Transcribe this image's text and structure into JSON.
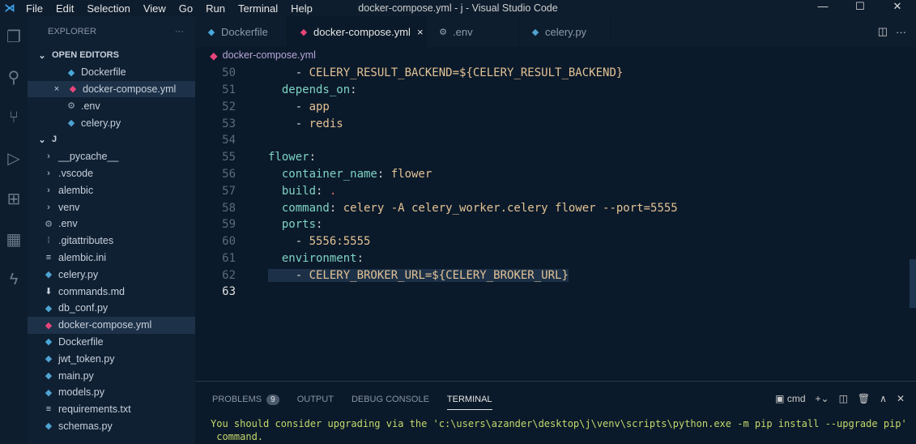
{
  "titlebar": {
    "menu": [
      "File",
      "Edit",
      "Selection",
      "View",
      "Go",
      "Run",
      "Terminal",
      "Help"
    ],
    "title": "docker-compose.yml - j - Visual Studio Code"
  },
  "sidebar": {
    "title": "EXPLORER",
    "more": "···",
    "open_editors": "OPEN EDITORS",
    "open_files": [
      {
        "name": "Dockerfile",
        "icon": "docker"
      },
      {
        "name": "docker-compose.yml",
        "icon": "docker-pink"
      },
      {
        "name": ".env",
        "icon": "gear"
      },
      {
        "name": "celery.py",
        "icon": "python"
      }
    ],
    "folder": "J",
    "items": [
      {
        "name": "__pycache__",
        "type": "folder"
      },
      {
        "name": ".vscode",
        "type": "folder"
      },
      {
        "name": "alembic",
        "type": "folder"
      },
      {
        "name": "venv",
        "type": "folder"
      },
      {
        "name": ".env",
        "type": "gear"
      },
      {
        "name": ".gitattributes",
        "type": "git"
      },
      {
        "name": "alembic.ini",
        "type": "ini"
      },
      {
        "name": "celery.py",
        "type": "python"
      },
      {
        "name": "commands.md",
        "type": "md"
      },
      {
        "name": "db_conf.py",
        "type": "python"
      },
      {
        "name": "docker-compose.yml",
        "type": "docker-pink"
      },
      {
        "name": "Dockerfile",
        "type": "docker"
      },
      {
        "name": "jwt_token.py",
        "type": "python"
      },
      {
        "name": "main.py",
        "type": "python"
      },
      {
        "name": "models.py",
        "type": "python"
      },
      {
        "name": "requirements.txt",
        "type": "txt"
      },
      {
        "name": "schemas.py",
        "type": "python"
      }
    ]
  },
  "tabs": [
    {
      "label": "Dockerfile"
    },
    {
      "label": "docker-compose.yml",
      "close": "×"
    },
    {
      "label": ".env"
    },
    {
      "label": "celery.py"
    }
  ],
  "breadcrumb": "docker-compose.yml",
  "code": [
    {
      "n": "50",
      "t": [
        [
          "p",
          "    - "
        ],
        [
          "v",
          "CELERY_RESULT_BACKEND=${CELERY_RESULT_BACKEND}"
        ]
      ]
    },
    {
      "n": "51",
      "t": [
        [
          "k",
          "  depends_on"
        ],
        [
          "p",
          ":"
        ]
      ]
    },
    {
      "n": "52",
      "t": [
        [
          "p",
          "    - "
        ],
        [
          "v",
          "app"
        ]
      ]
    },
    {
      "n": "53",
      "t": [
        [
          "p",
          "    - "
        ],
        [
          "v",
          "redis"
        ]
      ]
    },
    {
      "n": "54",
      "t": []
    },
    {
      "n": "55",
      "t": [
        [
          "k",
          "flower"
        ],
        [
          "p",
          ":"
        ]
      ]
    },
    {
      "n": "56",
      "t": [
        [
          "k",
          "  container_name"
        ],
        [
          "p",
          ": "
        ],
        [
          "v",
          "flower"
        ]
      ]
    },
    {
      "n": "57",
      "t": [
        [
          "k",
          "  build"
        ],
        [
          "p",
          ": "
        ],
        [
          "r",
          "."
        ]
      ]
    },
    {
      "n": "58",
      "t": [
        [
          "k",
          "  command"
        ],
        [
          "p",
          ": "
        ],
        [
          "v",
          "celery -A celery_worker.celery flower --port=5555"
        ]
      ]
    },
    {
      "n": "59",
      "t": [
        [
          "k",
          "  ports"
        ],
        [
          "p",
          ":"
        ]
      ]
    },
    {
      "n": "60",
      "t": [
        [
          "p",
          "    - "
        ],
        [
          "v",
          "5556:5555"
        ]
      ]
    },
    {
      "n": "61",
      "t": [
        [
          "k",
          "  environment"
        ],
        [
          "p",
          ":"
        ]
      ]
    },
    {
      "n": "62",
      "t": [
        [
          "p",
          "    - "
        ],
        [
          "v",
          "CELERY_BROKER_URL=${CELERY_BROKER_URL}"
        ]
      ]
    },
    {
      "n": "63",
      "t": []
    }
  ],
  "panel": {
    "tabs": [
      "PROBLEMS",
      "OUTPUT",
      "DEBUG CONSOLE",
      "TERMINAL"
    ],
    "problems_count": "9",
    "shell": "cmd",
    "terminal": "You should consider upgrading via the 'c:\\users\\azander\\desktop\\j\\venv\\scripts\\python.exe -m pip install --upgrade pip'\n command."
  }
}
